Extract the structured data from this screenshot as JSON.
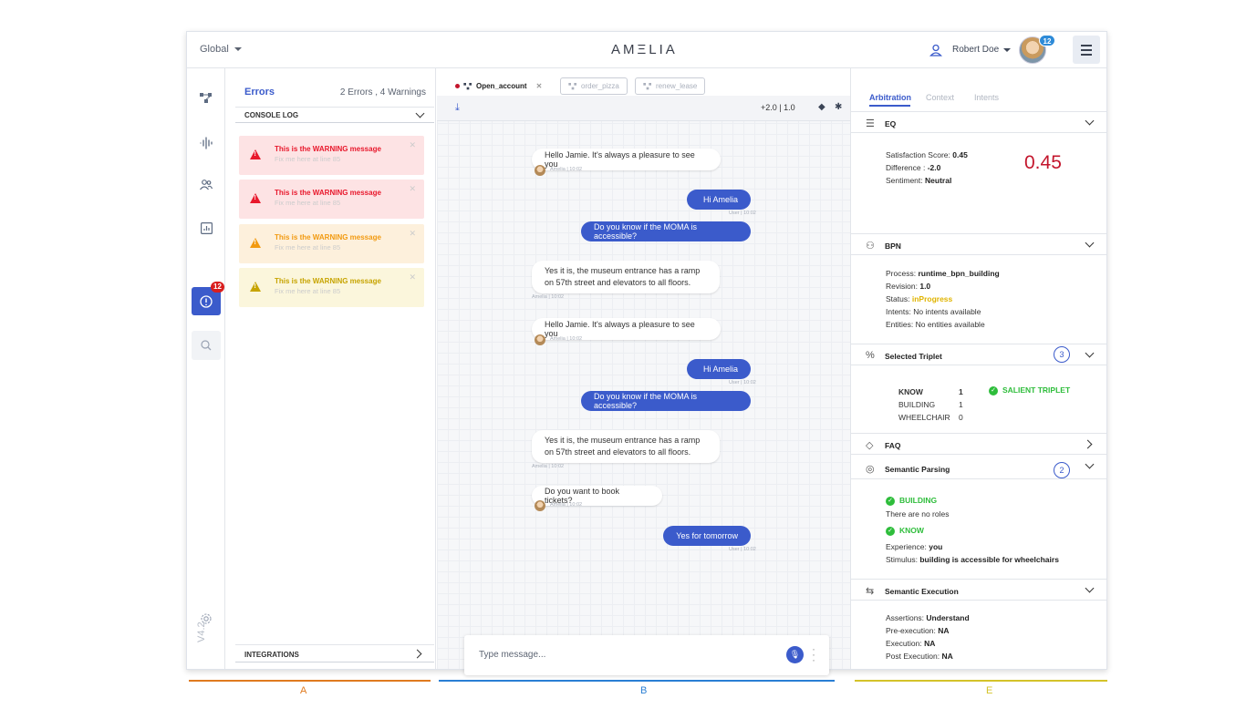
{
  "topbar": {
    "global_label": "Global",
    "logo": "AMΞLIA",
    "user_name": "Robert Doe",
    "avatar_badge": "12"
  },
  "rail": {
    "badge": "12",
    "version": "V4.2"
  },
  "errors": {
    "title": "Errors",
    "count": "2 Errors , 4 Warnings",
    "console_label": "CONSOLE LOG",
    "warnings": [
      {
        "message": "This is the WARNING message",
        "sub": "Fix me here at line 85",
        "color": "#e8182c",
        "bg": "#fde3e4"
      },
      {
        "message": "This is the WARNING message",
        "sub": "Fix me here at line 85",
        "color": "#e8182c",
        "bg": "#fde3e4"
      },
      {
        "message": "This is the WARNING message",
        "sub": "Fix me here at line 85",
        "color": "#f29a10",
        "bg": "#fdf0dc"
      },
      {
        "message": "This is the WARNING message",
        "sub": "Fix me here at line 85",
        "color": "#c7a400",
        "bg": "#fbf6dc"
      }
    ],
    "integrations_label": "INTEGRATIONS"
  },
  "chat": {
    "tabs": [
      "Open_account",
      "order_pizza",
      "renew_lease"
    ],
    "zoom": "+2.0  |  1.0",
    "messages": [
      {
        "who": "bot",
        "text": "Hello Jamie. It's always a pleasure to see you",
        "meta": "Amelia | 10:02"
      },
      {
        "who": "user",
        "text": "Hi Amelia",
        "meta": "User | 10:02"
      },
      {
        "who": "user",
        "text": "Do you know if the MOMA is accessible?",
        "meta": ""
      },
      {
        "who": "bot",
        "text": "Yes it is, the museum entrance has a ramp on 57th street and elevators to all floors.",
        "meta": "Amelia | 10:02"
      },
      {
        "who": "bot",
        "text": "Hello Jamie. It's always a pleasure to see you",
        "meta": "Amelia | 10:02"
      },
      {
        "who": "user",
        "text": "Hi Amelia",
        "meta": "User | 10:02"
      },
      {
        "who": "user",
        "text": "Do you know if the MOMA is accessible?",
        "meta": ""
      },
      {
        "who": "bot",
        "text": "Yes it is, the museum entrance has a ramp on 57th street and elevators to all floors.",
        "meta": "Amelia | 10:02"
      },
      {
        "who": "bot",
        "text": "Do you want to book tickets?",
        "meta": "Amelia | 10:02"
      },
      {
        "who": "user",
        "text": "Yes for tomorrow",
        "meta": "User | 10:02"
      }
    ],
    "input_placeholder": "Type message..."
  },
  "right": {
    "tabs": [
      "Arbitration",
      "Context",
      "Intents"
    ],
    "eq": {
      "title": "EQ",
      "satisfaction_label": "Satisfaction Score:",
      "satisfaction": "0.45",
      "difference_label": "Difference :",
      "difference": "-2.0",
      "sentiment_label": "Sentiment:",
      "sentiment": "Neutral",
      "big_score": "0.45"
    },
    "bpn": {
      "title": "BPN",
      "process_label": "Process:",
      "process": "runtime_bpn_building",
      "revision_label": "Revision:",
      "revision": "1.0",
      "status_label": "Status:",
      "status": "inProgress",
      "intents": "Intents: No intents available",
      "entities": "Entities: No entities available"
    },
    "triplet": {
      "title": "Selected Triplet",
      "count": "3",
      "rows": [
        {
          "k": "KNOW",
          "v": "1"
        },
        {
          "k": "BUILDING",
          "v": "1"
        },
        {
          "k": "WHEELCHAIR",
          "v": "0"
        }
      ],
      "salient": "SALIENT TRIPLET"
    },
    "faq": {
      "title": "FAQ"
    },
    "parsing": {
      "title": "Semantic Parsing",
      "count": "2",
      "building": "BUILDING",
      "no_roles": "There are no roles",
      "know": "KNOW",
      "experience_label": "Experience:",
      "experience": "you",
      "stimulus_label": "Stimulus:",
      "stimulus": "building is accessible for wheelchairs"
    },
    "execution": {
      "title": "Semantic Execution",
      "assertions_label": "Assertions:",
      "assertions": "Understand",
      "pre_label": "Pre-execution:",
      "pre": "NA",
      "exec_label": "Execution:",
      "exec": "NA",
      "post_label": "Post Execution:",
      "post": "NA"
    }
  },
  "footer": {
    "a": "A",
    "b": "B",
    "e": "E",
    "colors": {
      "a": "#e07a1f",
      "b": "#2a7fd4",
      "e": "#d4c32a"
    }
  }
}
